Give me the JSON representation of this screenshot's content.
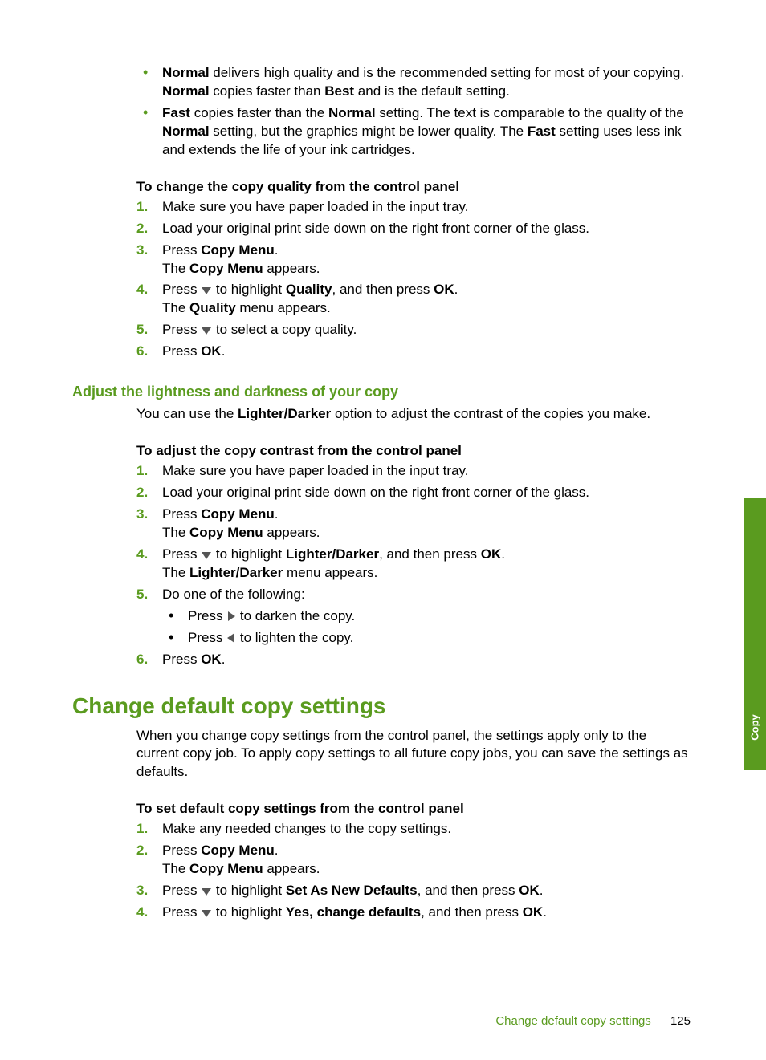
{
  "bullets_intro": {
    "normal": {
      "b1": "Normal",
      "t1": " delivers high quality and is the recommended setting for most of your copying. ",
      "b2": "Normal",
      "t2": " copies faster than ",
      "b3": "Best",
      "t3": " and is the default setting."
    },
    "fast": {
      "b1": "Fast",
      "t1": " copies faster than the ",
      "b2": "Normal",
      "t2": " setting. The text is comparable to the quality of the ",
      "b3": "Normal",
      "t3": " setting, but the graphics might be lower quality. The ",
      "b4": "Fast",
      "t4": " setting uses less ink and extends the life of your ink cartridges."
    }
  },
  "proc1": {
    "title": "To change the copy quality from the control panel",
    "s1": "Make sure you have paper loaded in the input tray.",
    "s2": "Load your original print side down on the right front corner of the glass.",
    "s3_a": "Press ",
    "s3_b": "Copy Menu",
    "s3_c": ".",
    "s3_d": "The ",
    "s3_e": "Copy Menu",
    "s3_f": " appears.",
    "s4_a": "Press ",
    "s4_b": " to highlight ",
    "s4_c": "Quality",
    "s4_d": ", and then press ",
    "s4_e": "OK",
    "s4_f": ".",
    "s4_g": "The ",
    "s4_h": "Quality",
    "s4_i": " menu appears.",
    "s5_a": "Press ",
    "s5_b": " to select a copy quality.",
    "s6_a": "Press ",
    "s6_b": "OK",
    "s6_c": "."
  },
  "section_adjust": {
    "heading": "Adjust the lightness and darkness of your copy",
    "intro_a": "You can use the ",
    "intro_b": "Lighter/Darker",
    "intro_c": " option to adjust the contrast of the copies you make."
  },
  "proc2": {
    "title": "To adjust the copy contrast from the control panel",
    "s1": "Make sure you have paper loaded in the input tray.",
    "s2": "Load your original print side down on the right front corner of the glass.",
    "s3_a": "Press ",
    "s3_b": "Copy Menu",
    "s3_c": ".",
    "s3_d": "The ",
    "s3_e": "Copy Menu",
    "s3_f": " appears.",
    "s4_a": "Press ",
    "s4_b": " to highlight ",
    "s4_c": "Lighter/Darker",
    "s4_d": ", and then press ",
    "s4_e": "OK",
    "s4_f": ".",
    "s4_g": "The ",
    "s4_h": "Lighter/Darker",
    "s4_i": " menu appears.",
    "s5": "Do one of the following:",
    "s5_b1_a": "Press ",
    "s5_b1_b": " to darken the copy.",
    "s5_b2_a": "Press ",
    "s5_b2_b": " to lighten the copy.",
    "s6_a": "Press ",
    "s6_b": "OK",
    "s6_c": "."
  },
  "section_change": {
    "heading": "Change default copy settings",
    "intro": "When you change copy settings from the control panel, the settings apply only to the current copy job. To apply copy settings to all future copy jobs, you can save the settings as defaults."
  },
  "proc3": {
    "title": "To set default copy settings from the control panel",
    "s1": "Make any needed changes to the copy settings.",
    "s2_a": "Press ",
    "s2_b": "Copy Menu",
    "s2_c": ".",
    "s2_d": "The ",
    "s2_e": "Copy Menu",
    "s2_f": " appears.",
    "s3_a": "Press ",
    "s3_b": " to highlight ",
    "s3_c": "Set As New Defaults",
    "s3_d": ", and then press ",
    "s3_e": "OK",
    "s3_f": ".",
    "s4_a": "Press ",
    "s4_b": " to highlight ",
    "s4_c": "Yes, change defaults",
    "s4_d": ", and then press ",
    "s4_e": "OK",
    "s4_f": "."
  },
  "side_tab": "Copy",
  "footer": {
    "title": "Change default copy settings",
    "page": "125"
  },
  "nums": {
    "1": "1.",
    "2": "2.",
    "3": "3.",
    "4": "4.",
    "5": "5.",
    "6": "6."
  }
}
